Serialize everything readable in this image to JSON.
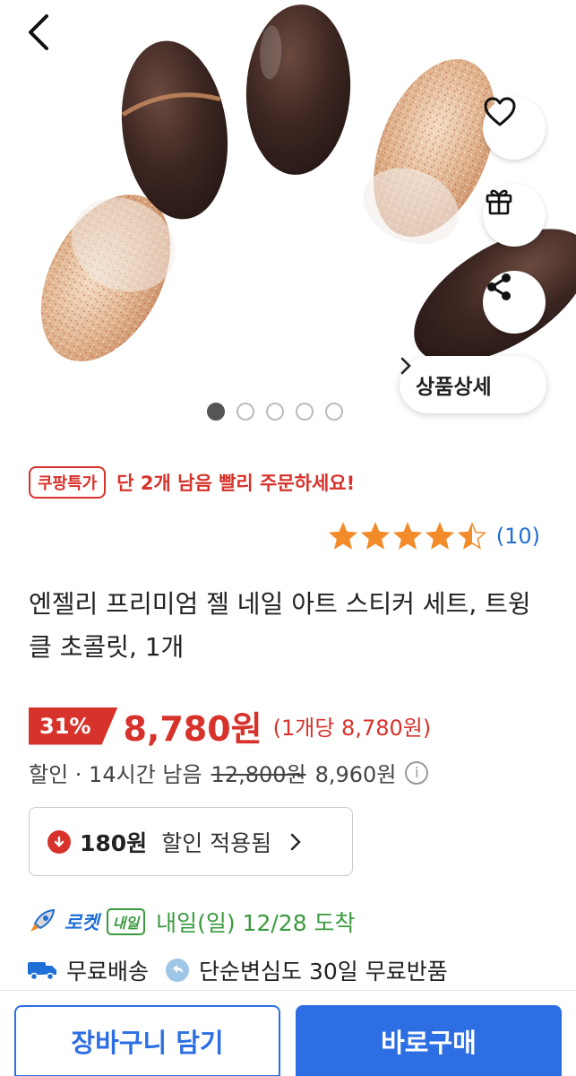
{
  "carousel": {
    "slides": 5,
    "active_index": 0
  },
  "hero": {
    "back_icon": "chevron-left-icon",
    "like_icon": "heart-icon",
    "gift_icon": "gift-icon",
    "share_icon": "share-icon",
    "detail_label": "상품상세",
    "detail_icon": "chevron-right-icon"
  },
  "promo": {
    "badge": "쿠팡특가",
    "text": "단 2개 남음 빨리 주문하세요!"
  },
  "rating": {
    "stars": 4.5,
    "count": "(10)"
  },
  "product": {
    "title": "엔젤리 프리미엄 젤 네일 아트 스티커 세트, 트윙클 초콜릿, 1개"
  },
  "price": {
    "discount_rate": "31%",
    "sale_price": "8,780원",
    "unit_price": "(1개당 8,780원)",
    "discount_label": "할인 · 14시간 남음",
    "original_price": "12,800원",
    "member_price": "8,960원",
    "info_icon": "info-icon"
  },
  "coupon": {
    "amount": "180원",
    "text": "할인 적용됨",
    "icon": "down-arrow-icon"
  },
  "delivery": {
    "rocket_label": "로켓",
    "tomorrow_badge": "내일",
    "arrival": "내일(일) 12/28 도착",
    "free_shipping": "무료배송",
    "return_policy": "단순변심도 30일 무료반품"
  },
  "actions": {
    "cart": "장바구니 담기",
    "buy": "바로구매"
  },
  "colors": {
    "accent_red": "#d7322b",
    "accent_blue": "#2d6fe3",
    "green": "#3a9a3e"
  }
}
